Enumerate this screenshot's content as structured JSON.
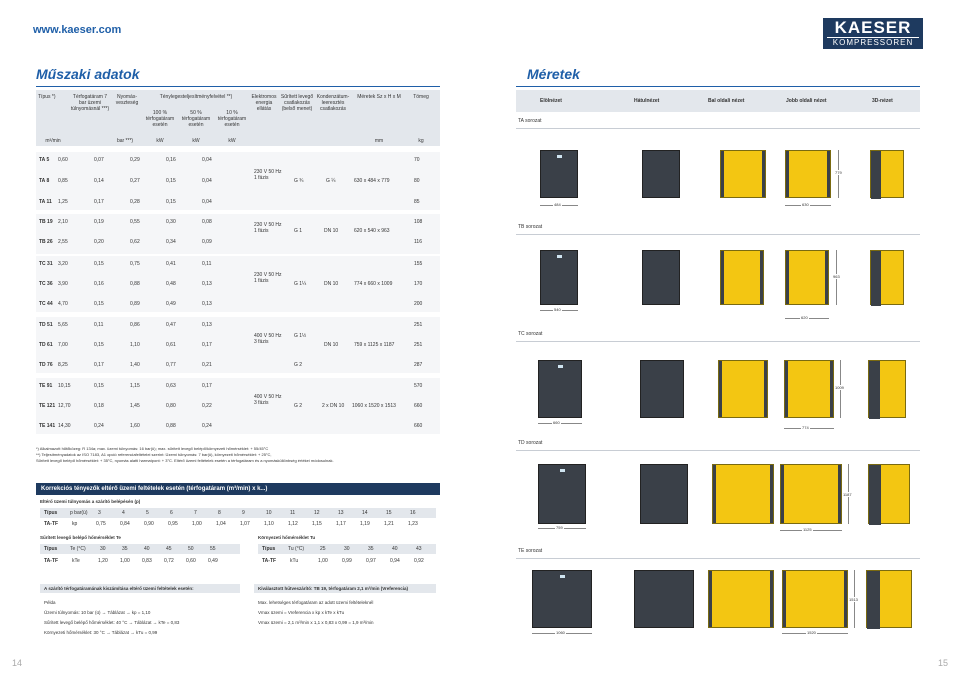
{
  "site_url": "www.kaeser.com",
  "logo": {
    "line1": "KAESER",
    "line2": "KOMPRESSOREN"
  },
  "left_title": "Műszaki adatok",
  "right_title": "Méretek",
  "spec": {
    "headers": [
      "Típus *)",
      "Térfogatáram 7 bar üzemi túlnyomásnál ***)",
      "Nyomás-veszteség",
      "Ténylegesteljesítményfelvétel **)",
      "Elektromos energia ellátás",
      "Sűrített levegő csatlakozás (belső menet)",
      "Kondenzátum-leeresztés csatlakozás",
      "Méretek Sz x H x M",
      "Tömeg"
    ],
    "sub_headers": [
      "100 % térfogatáram esetén",
      "50 % térfogatáram esetén",
      "10 % térfogatáram esetén"
    ],
    "units": [
      "m³/min",
      "bar ***)",
      "kW",
      "kW",
      "kW",
      "mm",
      "kg"
    ],
    "groups": [
      {
        "power": "230 V 50 Hz 1 fázis",
        "air": "G ¾",
        "cond": "G ¼",
        "dims": "630 x 484 x 779",
        "rows": [
          {
            "model": "TA 5",
            "flow": "0,60",
            "dp": "0,07",
            "p100": "0,29",
            "p50": "0,16",
            "p10": "0,04",
            "mass": "70"
          },
          {
            "model": "TA 8",
            "flow": "0,85",
            "dp": "0,14",
            "p100": "0,27",
            "p50": "0,15",
            "p10": "0,04",
            "mass": "80"
          },
          {
            "model": "TA 11",
            "flow": "1,25",
            "dp": "0,17",
            "p100": "0,28",
            "p50": "0,15",
            "p10": "0,04",
            "mass": "85"
          }
        ]
      },
      {
        "power": "230 V 50 Hz 1 fázis",
        "air": "G 1",
        "cond": "DN 10",
        "dims": "620 x 540 x 963",
        "rows": [
          {
            "model": "TB 19",
            "flow": "2,10",
            "dp": "0,19",
            "p100": "0,55",
            "p50": "0,30",
            "p10": "0,08",
            "mass": "108"
          },
          {
            "model": "TB 26",
            "flow": "2,55",
            "dp": "0,20",
            "p100": "0,62",
            "p50": "0,34",
            "p10": "0,09",
            "mass": "116"
          }
        ]
      },
      {
        "power": "230 V 50 Hz 1 fázis",
        "air": "G 1¼",
        "cond": "DN 10",
        "dims": "774 x 660 x 1009",
        "rows": [
          {
            "model": "TC 31",
            "flow": "3,20",
            "dp": "0,15",
            "p100": "0,75",
            "p50": "0,41",
            "p10": "0,11",
            "mass": "155"
          },
          {
            "model": "TC 36",
            "flow": "3,90",
            "dp": "0,16",
            "p100": "0,88",
            "p50": "0,48",
            "p10": "0,13",
            "mass": "170"
          },
          {
            "model": "TC 44",
            "flow": "4,70",
            "dp": "0,15",
            "p100": "0,89",
            "p50": "0,49",
            "p10": "0,13",
            "mass": "200"
          }
        ]
      },
      {
        "power": "400 V 50 Hz 3 fázis",
        "air": "G 1½",
        "air2": "G 2",
        "cond": "DN 10",
        "dims": "759 x 1125 x 1187",
        "rows": [
          {
            "model": "TD 51",
            "flow": "5,65",
            "dp": "0,11",
            "p100": "0,86",
            "p50": "0,47",
            "p10": "0,13",
            "mass": "251"
          },
          {
            "model": "TD 61",
            "flow": "7,00",
            "dp": "0,15",
            "p100": "1,10",
            "p50": "0,61",
            "p10": "0,17",
            "mass": "251"
          },
          {
            "model": "TD 76",
            "flow": "8,25",
            "dp": "0,17",
            "p100": "1,40",
            "p50": "0,77",
            "p10": "0,21",
            "mass": "287"
          }
        ]
      },
      {
        "power": "400 V 50 Hz 3 fázis",
        "air": "G 2",
        "cond": "2 x DN 10",
        "dims": "1060 x 1520 x 1513",
        "rows": [
          {
            "model": "TE 91",
            "flow": "10,15",
            "dp": "0,15",
            "p100": "1,15",
            "p50": "0,63",
            "p10": "0,17",
            "mass": "570"
          },
          {
            "model": "TE 121",
            "flow": "12,70",
            "dp": "0,18",
            "p100": "1,45",
            "p50": "0,80",
            "p10": "0,22",
            "mass": "660"
          },
          {
            "model": "TE 141",
            "flow": "14,30",
            "dp": "0,24",
            "p100": "1,60",
            "p50": "0,88",
            "p10": "0,24",
            "mass": "660"
          }
        ]
      }
    ]
  },
  "notes": [
    "*) Alkalmazott hűtőközeg: R 134a; max. üzemi túlnyomás: 16 bar(ü); max. sűrített levegő belépő/környezeti hőmérséklet: + 55/45°C",
    "**) Teljesítményadatok az ISO 7183, A1 opció referenciafeltételei szerint: Üzemi túlnyomás: 7 bar(ü), környezeti hőmérséklet: + 25°C,",
    "Sűrített levegő belépő hőmérséklet: + 35°C, nyomás alatti harmatpont: + 3°C. Eltérő üzemi feltételek esetén a térfogatáram és a nyomásküliönbség értékei módosulnak."
  ],
  "corr": {
    "title": "Korrekciós tényezők eltérő üzemi feltételek esetén (térfogatáram (m³/min) x k...)",
    "pressure_title": "Eltérő üzemi túlnyomás a szárító belépésén (p)",
    "pressure_head": [
      "Típus",
      "p bar(ü)",
      "3",
      "4",
      "5",
      "6",
      "7",
      "8",
      "9",
      "10",
      "11",
      "12",
      "13",
      "14",
      "15",
      "16"
    ],
    "pressure_row": [
      "TA-TF",
      "kp",
      "0,75",
      "0,84",
      "0,90",
      "0,95",
      "1,00",
      "1,04",
      "1,07",
      "1,10",
      "1,12",
      "1,15",
      "1,17",
      "1,19",
      "1,21",
      "1,23"
    ],
    "temp_title": "Sűrített levegő belépő hőmérséklet Te",
    "temp_head": [
      "Típus",
      "Te (°C)",
      "30",
      "35",
      "40",
      "45",
      "50",
      "55"
    ],
    "temp_row": [
      "TA-TF",
      "kTe",
      "1,20",
      "1,00",
      "0,83",
      "0,72",
      "0,60",
      "0,49"
    ],
    "amb_title": "Környezeti hőmérséklet Tu",
    "amb_head": [
      "Típus",
      "Tu (°C)",
      "25",
      "30",
      "35",
      "40",
      "43"
    ],
    "amb_row": [
      "TA-TF",
      "kTu",
      "1,00",
      "0,99",
      "0,97",
      "0,94",
      "0,92"
    ]
  },
  "calc": {
    "left_title": "A szárító térfogatáramának kiszámítása eltérő üzemi feltételek esetén:",
    "left_lines": [
      "Példa",
      "Üzemi túlnyomás:   10 bar (ü)   → Táblázat   → kp = 1,10",
      "Sűrített levegő belépő hőmérséklet:   40 °C   → Táblázat   → kTe = 0,83",
      "Környezeti hőmérséklet:   30 °C   → Táblázat   → kTu = 0,99"
    ],
    "right_title": "Kiválasztott hűtveszárító: TB 19, térfogatáram 2,1 m³/min (Vreferencia)",
    "right_lines": [
      "Max. lehetséges térfogatáram az adott üzemi feltételeknél",
      "Vmax üzemi = Vreferencia x kp x kTe x kTu",
      "Vmax üzemi = 2,1 m³/min x 1,1 x 0,83 x 0,99 = 1,9 m³/min"
    ]
  },
  "dims": {
    "views": [
      "Elölnézet",
      "Hátulnézet",
      "Bal oldali nézet",
      "Jobb oldali nézet",
      "3D-nézet"
    ],
    "series": [
      "TA sorozat",
      "TB sorozat",
      "TC sorozat",
      "TD sorozat",
      "TE sorozat"
    ],
    "TA": {
      "w": "484",
      "d": "630",
      "h": "779"
    },
    "TB": {
      "w": "540",
      "d": "620",
      "h": "963"
    },
    "TC": {
      "w": "660",
      "d": "774",
      "h": "1009"
    },
    "TD": {
      "w": "759",
      "d": "1125",
      "h": "1187"
    },
    "TE": {
      "w": "1060",
      "d": "1520",
      "h": "1513"
    }
  },
  "pages": {
    "left": "14",
    "right": "15"
  },
  "colors": {
    "accent": "#1f5fa8",
    "navy": "#1e3a5f",
    "yellow": "#f3c612",
    "cabinet_dark": "#3a4048"
  }
}
